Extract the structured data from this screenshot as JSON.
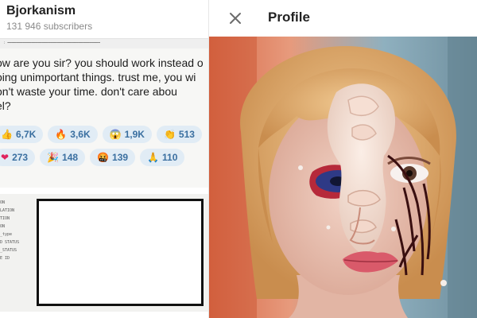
{
  "channel": {
    "name": "Bjorkanism",
    "subscribers": "131 946 subscribers"
  },
  "message": {
    "lines": [
      "ow are you sir? you should work instead o",
      "oing unimportant things. trust me, you wi",
      "on't waste your time. don't care abou",
      "el?"
    ]
  },
  "reactions": {
    "row1": [
      {
        "emoji": "👍",
        "count": "6,7K"
      },
      {
        "emoji": "🔥",
        "count": "3,6K"
      },
      {
        "emoji": "😱",
        "count": "1,9K"
      },
      {
        "emoji": "👏",
        "count": "513"
      }
    ],
    "row2": [
      {
        "emoji": "❤",
        "count": "273"
      },
      {
        "emoji": "🎉",
        "count": "148"
      },
      {
        "emoji": "🤬",
        "count": "139"
      },
      {
        "emoji": "🙏",
        "count": "110"
      }
    ]
  },
  "document": {
    "lines": [
      "ON",
      "LATION",
      "TION",
      "ON",
      "_type",
      "D STATUS",
      "_STATUS",
      "E ID"
    ]
  },
  "profile": {
    "title": "Profile",
    "close_icon": "close-icon"
  },
  "colors": {
    "reaction_bg": "#e1ecf5",
    "reaction_text": "#3a6fa0"
  }
}
